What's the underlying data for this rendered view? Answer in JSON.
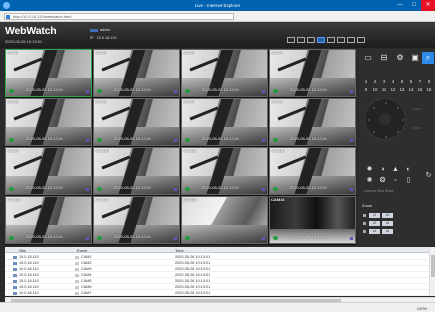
{
  "window": {
    "title": "Live - Internet Explorer",
    "min": "—",
    "max": "□",
    "close": "✕",
    "address": "http://10.0.18.110/webwatch.html"
  },
  "header": {
    "logo": "WebWatch",
    "datetime": "2020-05-26 10:13:01",
    "user_label": "admin",
    "ip_prefix": "IP",
    "ip_value": "10.0.18.110"
  },
  "cameras": [
    {
      "label": "CAM1",
      "time": "2020-05-26 10:13:01"
    },
    {
      "label": "CAM2",
      "time": "2020-05-26 10:13:01"
    },
    {
      "label": "CAM3",
      "time": "2020-05-26 10:13:01"
    },
    {
      "label": "CAM4",
      "time": "2020-05-26 10:13:01"
    },
    {
      "label": "CAM5",
      "time": "2020-05-26 10:13:01"
    },
    {
      "label": "CAM6",
      "time": "2020-05-26 10:13:01"
    },
    {
      "label": "CAM7",
      "time": "2020-05-26 10:13:01"
    },
    {
      "label": "CAM8",
      "time": "2020-05-26 10:13:01"
    },
    {
      "label": "CAM9",
      "time": "2020-05-26 10:13:01"
    },
    {
      "label": "CAM10",
      "time": "2020-05-26 10:13:01"
    },
    {
      "label": "CAM11",
      "time": "2020-05-26 10:13:01"
    },
    {
      "label": "CAM12",
      "time": "2020-05-26 10:13:01"
    },
    {
      "label": "CAM13",
      "time": "2020-05-26 10:13:01"
    },
    {
      "label": "CAM14",
      "time": "2020-05-26 10:13:01"
    },
    {
      "label": "CAM15",
      "time": ""
    },
    {
      "label": "CAM16",
      "time": "2020-05-26 10:13:01"
    }
  ],
  "panel": {
    "channel_numbers": [
      "1",
      "2",
      "3",
      "4",
      "5",
      "6",
      "7",
      "8",
      "9",
      "10",
      "11",
      "12",
      "13",
      "14",
      "15",
      "16"
    ],
    "ptz_side_top": "Zoom",
    "ptz_side_bottom": "Focus",
    "image_adjust_caption": "Camera Shot Setup",
    "zoom_label": "Zoom",
    "zoom_buttons": [
      "x1",
      "x2",
      "x4"
    ]
  },
  "list": {
    "columns": [
      "Site",
      "Event",
      "Time"
    ],
    "rows": [
      {
        "site": "10.0.18.110",
        "event": "CAM1",
        "time": "2020-05-26 10:13:01"
      },
      {
        "site": "10.0.18.110",
        "event": "CAM2",
        "time": "2020-05-26 10:13:01"
      },
      {
        "site": "10.0.18.110",
        "event": "CAM3",
        "time": "2020-05-26 10:13:01"
      },
      {
        "site": "10.0.18.110",
        "event": "CAM4",
        "time": "2020-05-26 10:13:01"
      },
      {
        "site": "10.0.18.110",
        "event": "CAM5",
        "time": "2020-05-26 10:13:01"
      },
      {
        "site": "10.0.18.110",
        "event": "CAM6",
        "time": "2020-05-26 10:13:01"
      },
      {
        "site": "10.0.18.110",
        "event": "CAM7",
        "time": "2020-05-26 10:13:01"
      }
    ]
  },
  "status": {
    "zoom": "100%"
  }
}
